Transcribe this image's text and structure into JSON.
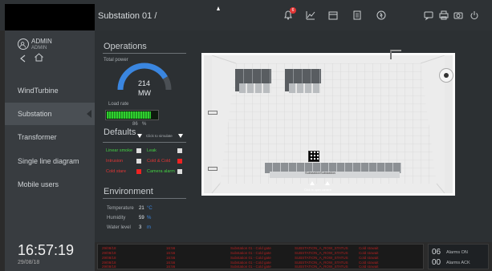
{
  "header": {
    "title": "Substation 01 /",
    "alarm_count": "6"
  },
  "sidebar": {
    "user_name": "ADMIN",
    "user_role": "ADMIN",
    "items": [
      {
        "label": "WindTurbine"
      },
      {
        "label": "Substation"
      },
      {
        "label": "Transformer"
      },
      {
        "label": "Single line diagram"
      },
      {
        "label": "Mobile users"
      }
    ],
    "time": "16:57:19",
    "date": "29/08/18"
  },
  "operations": {
    "title": "Operations",
    "total_power_label": "Total power",
    "power_value": "214",
    "power_unit": "MW",
    "load_rate_label": "Load rate",
    "load_rate_value": "86",
    "load_rate_unit": "%",
    "load_rate_fraction": 0.86
  },
  "defaults": {
    "title": "Defaults",
    "simulate_label": "Click to simulate",
    "items": [
      {
        "label": "Linear smoke",
        "color": "#43d043",
        "state": "off"
      },
      {
        "label": "Leak",
        "color": "#43d043",
        "state": "off"
      },
      {
        "label": "Intrusion",
        "color": "#e23535",
        "state": "off"
      },
      {
        "label": "Cold & Cold",
        "color": "#e23535",
        "state": "on"
      },
      {
        "label": "Cold stare",
        "color": "#e23535",
        "state": "on"
      },
      {
        "label": "Camera alarm",
        "color": "#43d043",
        "state": "off"
      }
    ]
  },
  "environment": {
    "title": "Environment",
    "rows": [
      {
        "label": "Temperature",
        "value": "21",
        "unit": "°C"
      },
      {
        "label": "Humidity",
        "value": "59",
        "unit": "%"
      },
      {
        "label": "Water level",
        "value": "3",
        "unit": "m"
      }
    ]
  },
  "scene": {
    "label_left": "Substation",
    "label_right": "Substation",
    "hint": "Click to open camera"
  },
  "alarms": {
    "on_count": "06",
    "on_label": "Alarms ON",
    "ack_count": "00",
    "ack_label": "Alarms ACK"
  },
  "log": [
    {
      "c1": "29/08/18",
      "c2": "16:56",
      "c3": "Substation 01 - Cold gate",
      "c4": "SUBSTATION_A_ROW_STATUS",
      "c5": "Cold stowait"
    },
    {
      "c1": "29/08/18",
      "c2": "16:56",
      "c3": "Substation 01 - Cold gate",
      "c4": "SUBSTATION_A_ROW_STATUS",
      "c5": "Cold stowait"
    },
    {
      "c1": "29/08/18",
      "c2": "16:56",
      "c3": "Substation 01 - Cold gate",
      "c4": "SUBSTATION_A_ROW_STATUS",
      "c5": "Cold stowait"
    },
    {
      "c1": "29/08/18",
      "c2": "16:56",
      "c3": "Substation 01 - Cold gate",
      "c4": "SUBSTATION_A_ROW_STATUS",
      "c5": "Cold stowait"
    },
    {
      "c1": "29/08/18",
      "c2": "16:56",
      "c3": "Substation 01 - Cold gate",
      "c4": "SUBSTATION_A_ROW_STATUS",
      "c5": "Cold stowait"
    }
  ],
  "colors": {
    "accent": "#3a86e0",
    "alarm": "#e23535",
    "ok": "#43d043"
  }
}
